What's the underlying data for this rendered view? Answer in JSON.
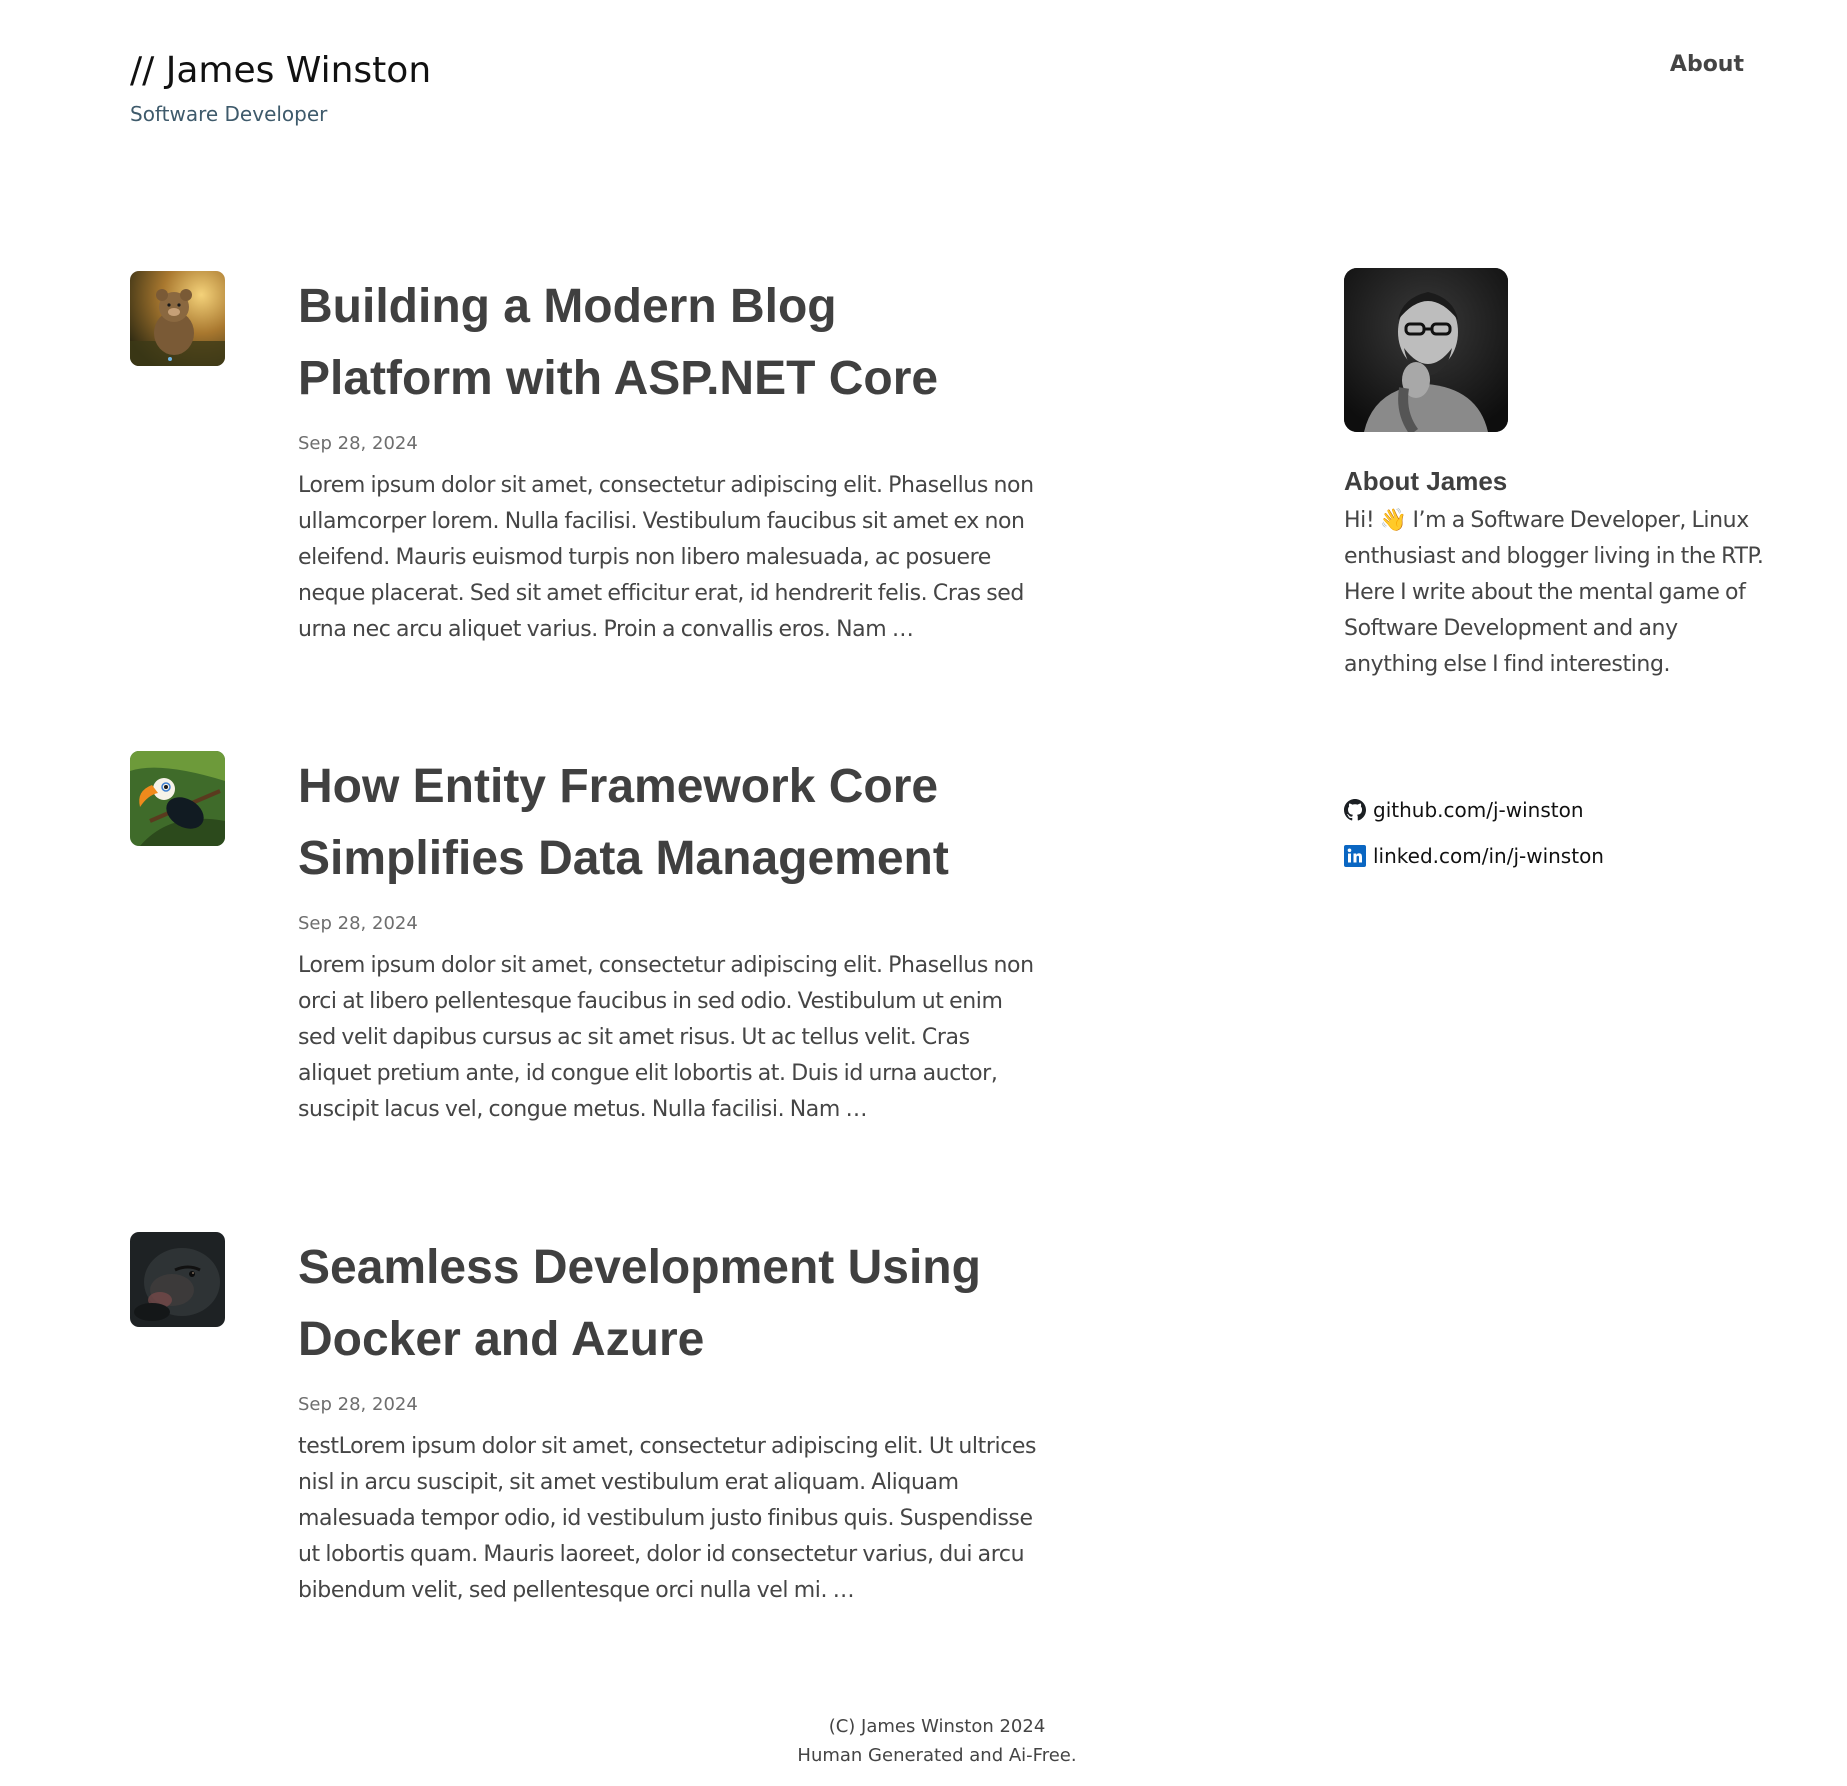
{
  "header": {
    "site_title": "// James Winston",
    "site_subtitle": "Software Developer",
    "nav_about": "About"
  },
  "posts": [
    {
      "title": "Building a Modern Blog Platform with ASP.NET Core",
      "date": "Sep 28, 2024",
      "excerpt": "Lorem ipsum dolor sit amet, consectetur adipiscing elit. Phasellus non ullamcorper lorem. Nulla facilisi. Vestibulum faucibus sit amet ex non eleifend. Mauris euismod turpis non libero malesuada, ac posuere neque placerat. Sed sit amet efficitur erat, id hendrerit felis. Cras sed urna nec arcu aliquet varius. Proin a convallis eros. Nam …",
      "thumb_icon": "teddy-bear-thumbnail"
    },
    {
      "title": "How Entity Framework Core Simplifies Data Management",
      "date": "Sep 28, 2024",
      "excerpt": "Lorem ipsum dolor sit amet, consectetur adipiscing elit. Phasellus non orci at libero pellentesque faucibus in sed odio. Vestibulum ut enim sed velit dapibus cursus ac sit amet risus. Ut ac tellus velit. Cras aliquet pretium ante, id congue elit lobortis at. Duis id urna auctor, suscipit lacus vel, congue metus. Nulla facilisi. Nam …",
      "thumb_icon": "toucan-thumbnail"
    },
    {
      "title": "Seamless Development Using Docker and Azure",
      "date": "Sep 28, 2024",
      "excerpt": "testLorem ipsum dolor sit amet, consectetur adipiscing elit. Ut ultrices nisl in arcu suscipit, sit amet vestibulum erat aliquam. Aliquam malesuada tempor odio, id vestibulum justo finibus quis. Suspendisse ut lobortis quam. Mauris laoreet, dolor id consectetur varius, dui arcu bibendum velit, sed pellentesque orci nulla vel mi. …",
      "thumb_icon": "gorilla-thumbnail"
    }
  ],
  "sidebar": {
    "about_heading": "About James",
    "about_text": "Hi! 👋 I’m a Software Developer, Linux enthusiast and blogger living in the RTP. Here I write about the mental game of Software Development and any anything else I find interesting.",
    "links": [
      {
        "label": "github.com/j-winston",
        "icon": "github-icon"
      },
      {
        "label": "linked.com/in/j-winston",
        "icon": "linkedin-icon"
      }
    ]
  },
  "footer": {
    "line1": "(C) James Winston 2024",
    "line2": "Human Generated and Ai-Free."
  },
  "colors": {
    "title_text": "#404040",
    "body_text": "#454545",
    "subtitle": "#3e5a6b",
    "date": "#6e6e6e",
    "linkedin_blue": "#0a66c2"
  }
}
